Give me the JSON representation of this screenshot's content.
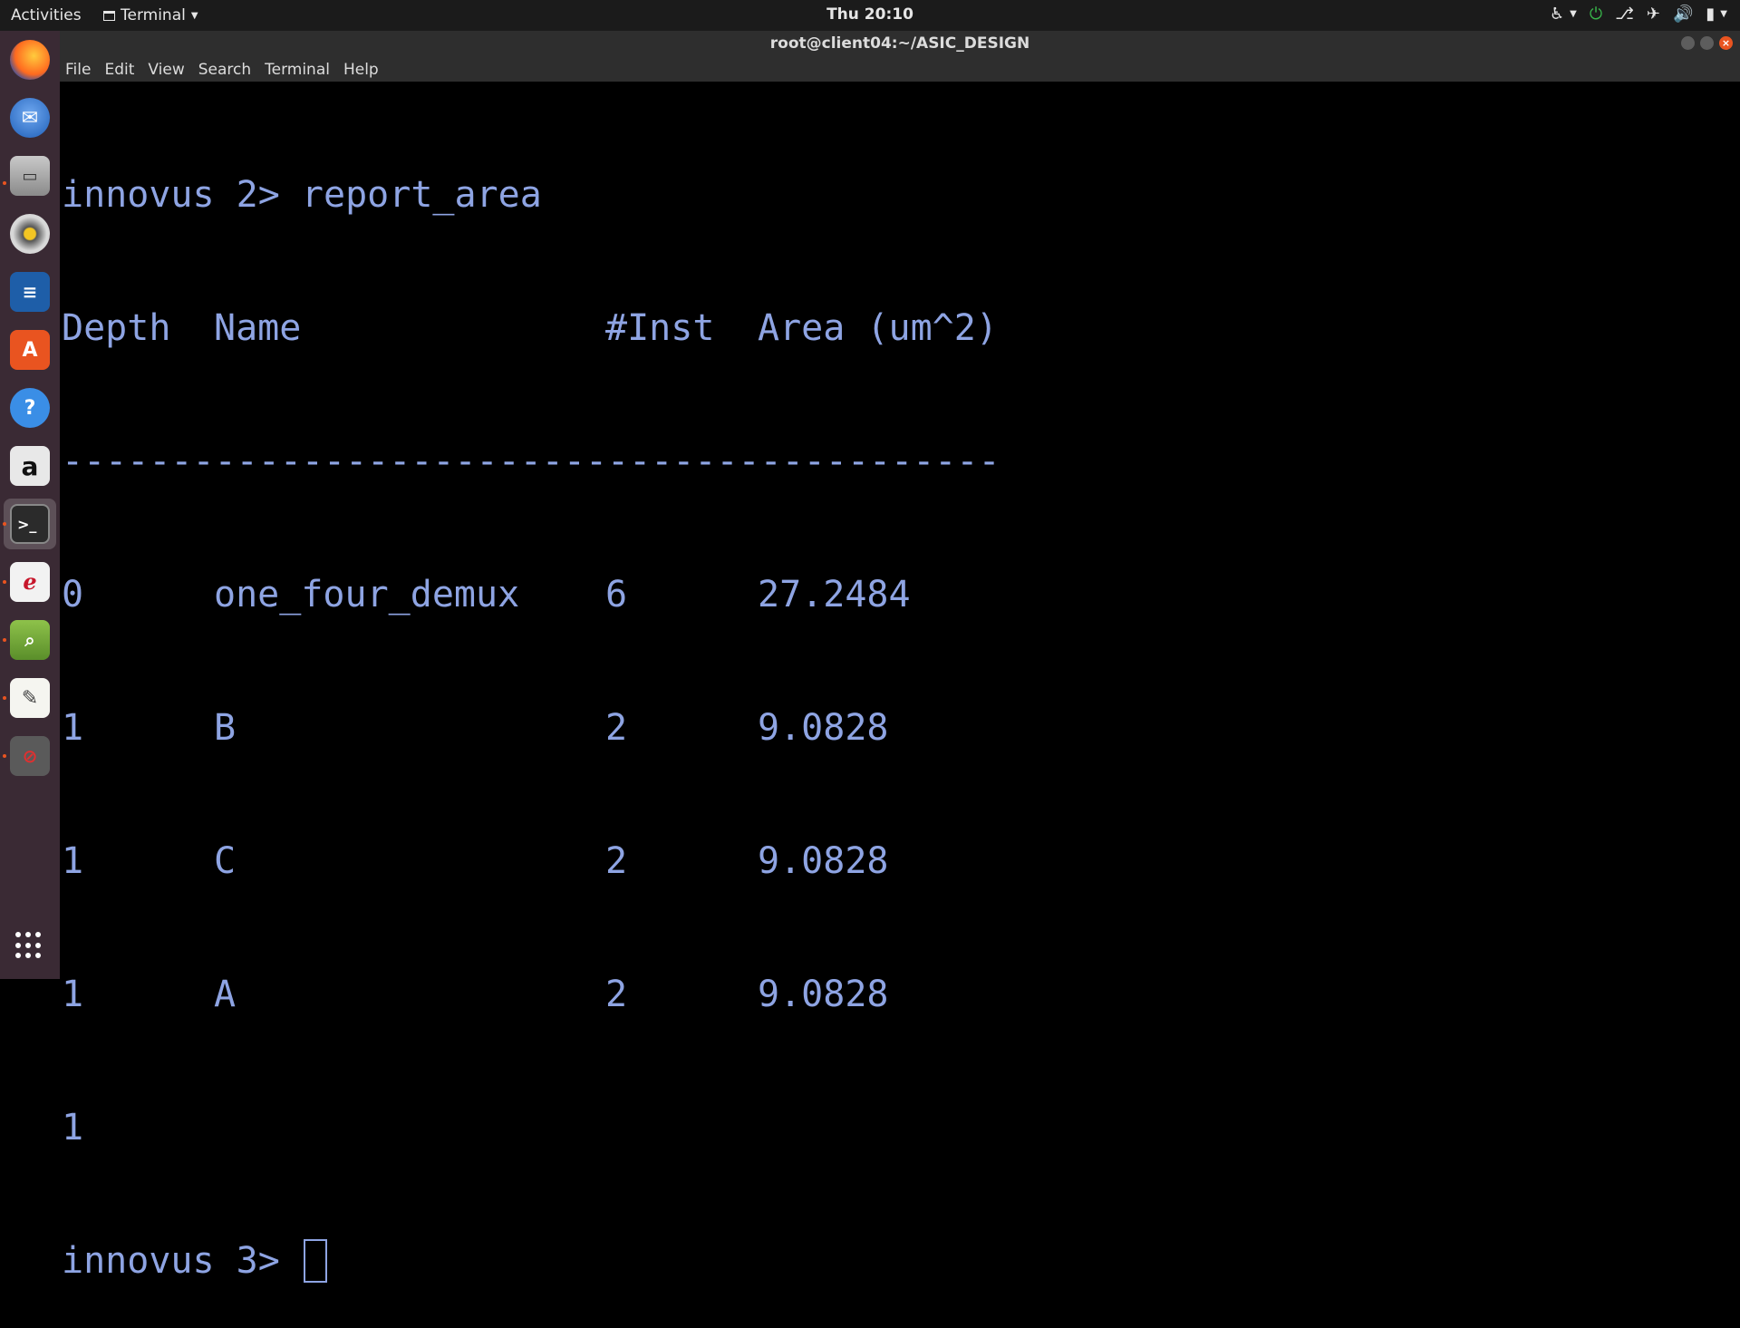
{
  "topbar": {
    "activities": "Activities",
    "app_menu": "Terminal",
    "clock": "Thu 20:10"
  },
  "dock": {
    "items": [
      {
        "name": "firefox",
        "icon": "firefox-icon"
      },
      {
        "name": "thunderbird",
        "icon": "mail-icon"
      },
      {
        "name": "files",
        "icon": "files-icon"
      },
      {
        "name": "rhythmbox",
        "icon": "music-icon"
      },
      {
        "name": "writer",
        "icon": "document-icon"
      },
      {
        "name": "software",
        "icon": "software-center-icon"
      },
      {
        "name": "help",
        "icon": "help-icon"
      },
      {
        "name": "amazon",
        "icon": "amazon-icon"
      },
      {
        "name": "terminal",
        "icon": "terminal-icon",
        "active": true
      },
      {
        "name": "evince",
        "icon": "pdf-viewer-icon"
      },
      {
        "name": "image-viewer",
        "icon": "image-viewer-icon"
      },
      {
        "name": "text-editor",
        "icon": "text-editor-icon"
      },
      {
        "name": "app",
        "icon": "app-icon"
      }
    ]
  },
  "window": {
    "title": "root@client04:~/ASIC_DESIGN",
    "menu": [
      "File",
      "Edit",
      "View",
      "Search",
      "Terminal",
      "Help"
    ]
  },
  "terminal": {
    "command_line": "innovus 2> report_area",
    "headers": [
      "Depth",
      "Name",
      "#Inst",
      "Area (um^2)"
    ],
    "separator": "-------------------------------------------",
    "rows": [
      [
        "0",
        "one_four_demux",
        "6",
        "27.2484"
      ],
      [
        "1",
        "B",
        "2",
        "9.0828"
      ],
      [
        "1",
        "C",
        "2",
        "9.0828"
      ],
      [
        "1",
        "A",
        "2",
        "9.0828"
      ]
    ],
    "return_value": "1",
    "prompt": "innovus 3> "
  },
  "colors": {
    "terminal_fg": "#8ea4e3",
    "terminal_bg": "#000000",
    "dock_bg": "#3a2a34",
    "accent": "#e95420"
  }
}
